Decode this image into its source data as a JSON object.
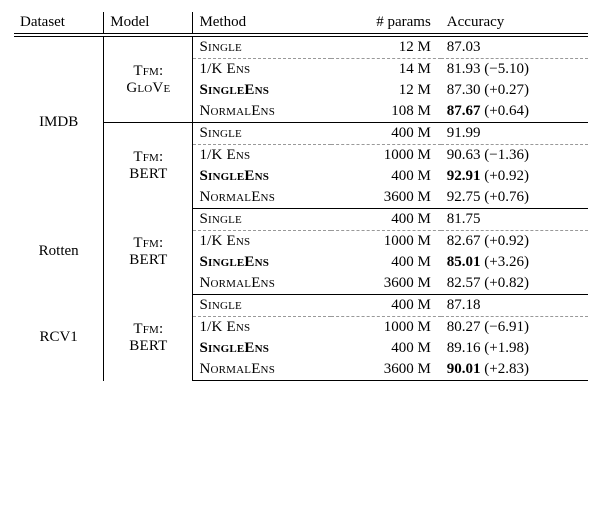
{
  "chart_data": {
    "type": "table",
    "title": "",
    "columns": [
      "Dataset",
      "Model",
      "Method",
      "# params",
      "Accuracy"
    ],
    "datasets": [
      {
        "name": "IMDB",
        "models": [
          {
            "name_top": "Tfm:",
            "name_bottom": "GloVe",
            "rows": [
              {
                "method": "Single",
                "method_bold": false,
                "params": "12 M",
                "acc": "87.03",
                "acc_bold": false,
                "delta": ""
              },
              {
                "method": "1/K Ens",
                "method_bold": false,
                "params": "14 M",
                "acc": "81.93",
                "acc_bold": false,
                "delta": "(−5.10)"
              },
              {
                "method": "SingleEns",
                "method_bold": true,
                "params": "12 M",
                "acc": "87.30",
                "acc_bold": false,
                "delta": "(+0.27)"
              },
              {
                "method": "NormalEns",
                "method_bold": false,
                "params": "108 M",
                "acc": "87.67",
                "acc_bold": true,
                "delta": "(+0.64)"
              }
            ]
          },
          {
            "name_top": "Tfm:",
            "name_bottom": "BERT",
            "rows": [
              {
                "method": "Single",
                "method_bold": false,
                "params": "400 M",
                "acc": "91.99",
                "acc_bold": false,
                "delta": ""
              },
              {
                "method": "1/K Ens",
                "method_bold": false,
                "params": "1000 M",
                "acc": "90.63",
                "acc_bold": false,
                "delta": "(−1.36)"
              },
              {
                "method": "SingleEns",
                "method_bold": true,
                "params": "400 M",
                "acc": "92.91",
                "acc_bold": true,
                "delta": "(+0.92)"
              },
              {
                "method": "NormalEns",
                "method_bold": false,
                "params": "3600 M",
                "acc": "92.75",
                "acc_bold": false,
                "delta": "(+0.76)"
              }
            ]
          }
        ]
      },
      {
        "name": "Rotten",
        "models": [
          {
            "name_top": "Tfm:",
            "name_bottom": "BERT",
            "rows": [
              {
                "method": "Single",
                "method_bold": false,
                "params": "400 M",
                "acc": "81.75",
                "acc_bold": false,
                "delta": ""
              },
              {
                "method": "1/K Ens",
                "method_bold": false,
                "params": "1000 M",
                "acc": "82.67",
                "acc_bold": false,
                "delta": "(+0.92)"
              },
              {
                "method": "SingleEns",
                "method_bold": true,
                "params": "400 M",
                "acc": "85.01",
                "acc_bold": true,
                "delta": "(+3.26)"
              },
              {
                "method": "NormalEns",
                "method_bold": false,
                "params": "3600 M",
                "acc": "82.57",
                "acc_bold": false,
                "delta": "(+0.82)"
              }
            ]
          }
        ]
      },
      {
        "name": "RCV1",
        "models": [
          {
            "name_top": "Tfm:",
            "name_bottom": "BERT",
            "rows": [
              {
                "method": "Single",
                "method_bold": false,
                "params": "400 M",
                "acc": "87.18",
                "acc_bold": false,
                "delta": ""
              },
              {
                "method": "1/K Ens",
                "method_bold": false,
                "params": "1000 M",
                "acc": "80.27",
                "acc_bold": false,
                "delta": "(−6.91)"
              },
              {
                "method": "SingleEns",
                "method_bold": true,
                "params": "400 M",
                "acc": "89.16",
                "acc_bold": false,
                "delta": "(+1.98)"
              },
              {
                "method": "NormalEns",
                "method_bold": false,
                "params": "3600 M",
                "acc": "90.01",
                "acc_bold": true,
                "delta": "(+2.83)"
              }
            ]
          }
        ]
      }
    ]
  }
}
